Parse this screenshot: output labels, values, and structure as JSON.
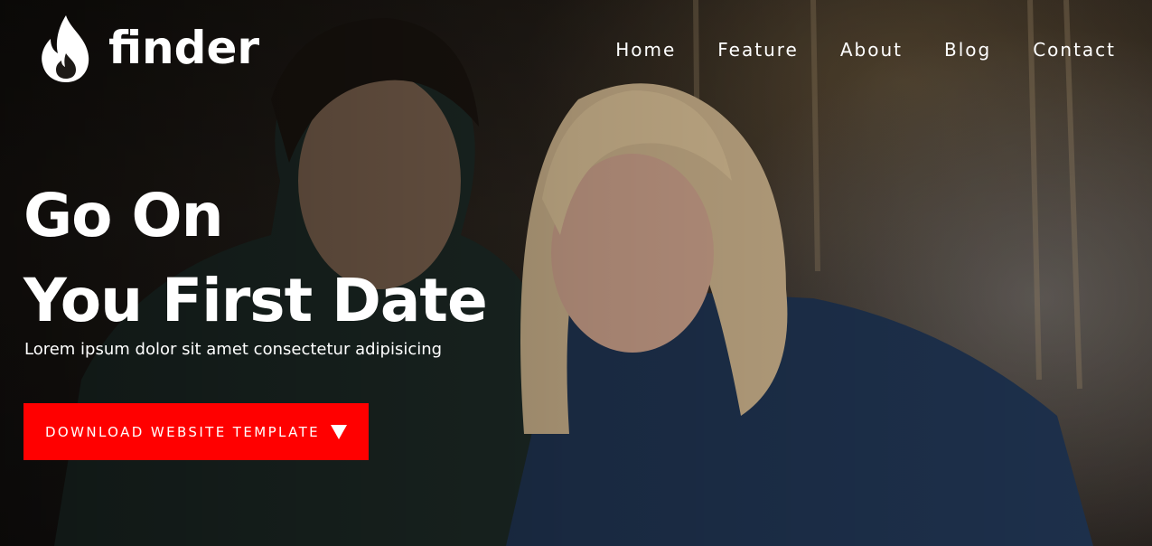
{
  "brand": {
    "name": "finder",
    "logo_icon": "flame-icon"
  },
  "nav": {
    "items": [
      {
        "label": "Home"
      },
      {
        "label": "Feature"
      },
      {
        "label": "About"
      },
      {
        "label": "Blog"
      },
      {
        "label": "Contact"
      }
    ]
  },
  "hero": {
    "headline_line1": "Go On",
    "headline_line2": "You First Date",
    "subtitle": "Lorem ipsum dolor sit amet consectetur adipisicing",
    "cta_label": "DOWNLOAD WEBSITE TEMPLATE",
    "cta_icon": "triangle-down-icon"
  },
  "colors": {
    "accent": "#ff0000",
    "text": "#ffffff"
  }
}
